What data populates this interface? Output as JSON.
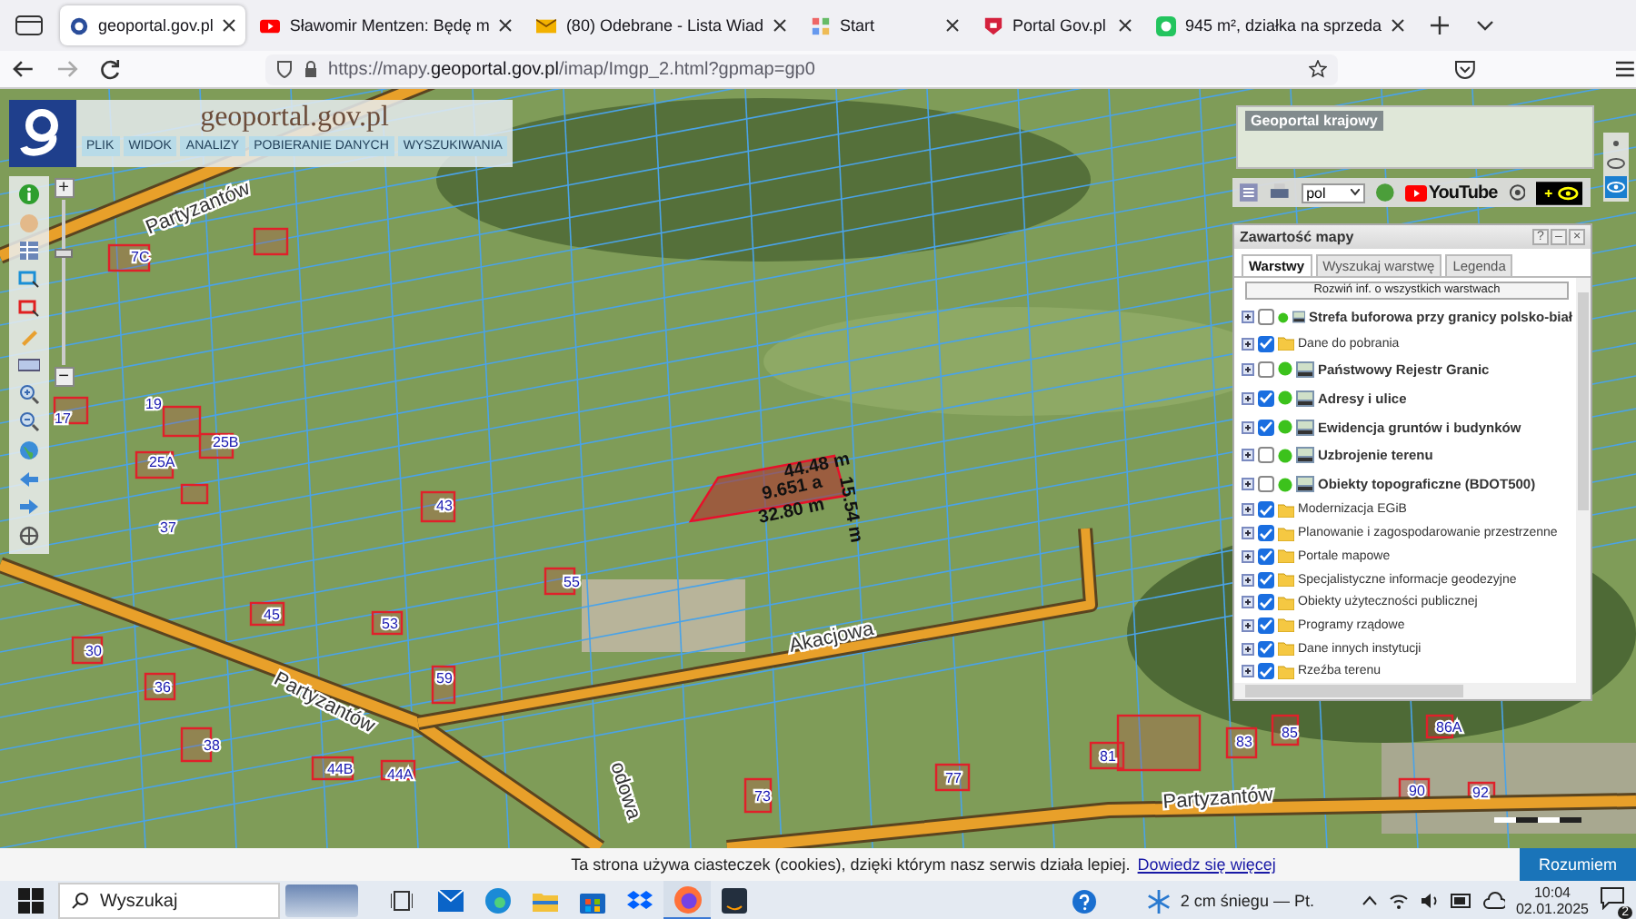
{
  "browser": {
    "tabs": [
      {
        "title": "geoportal.gov.pl",
        "kind": "geoportal",
        "selected": true
      },
      {
        "title": "Sławomir Mentzen: Będę m",
        "kind": "video",
        "selected": false
      },
      {
        "title": "(80) Odebrane - Lista Wiad",
        "kind": "mail",
        "selected": false
      },
      {
        "title": "Start",
        "kind": "start",
        "selected": false
      },
      {
        "title": "Portal Gov.pl",
        "kind": "gov",
        "selected": false
      },
      {
        "title": "945 m², działka na sprzeda",
        "kind": "listing",
        "selected": false
      }
    ],
    "url": "https://mapy.**geoportal.gov.pl**/imap/Imgp_2.html?gpmap=gp0"
  },
  "map": {
    "header": {
      "logo_title": "geoportal.gov.pl",
      "menu": [
        "PLIK",
        "WIDOK",
        "ANALIZY",
        "POBIERANIE DANYCH",
        "WYSZUKIWANIA"
      ]
    },
    "zoom": {
      "in": "+",
      "out": "−",
      "level": 0.7
    },
    "street_labels": [
      "Partyzantów",
      "Partyzantów",
      "Akacjowa",
      "Partyzantów",
      "odowa"
    ],
    "house_numbers": [
      "7C",
      "25B",
      "25A",
      "17",
      "19",
      "43",
      "37",
      "55",
      "53",
      "45",
      "59",
      "38",
      "44B",
      "44A",
      "73",
      "77",
      "81",
      "83",
      "85",
      "86A",
      "90",
      "92",
      "30",
      "36"
    ],
    "measurements": [
      "44.48 m",
      "9.651 a",
      "32.80 m",
      "15.54 m"
    ],
    "overview": {
      "title": "Geoportal krajowy"
    },
    "toolbar": {
      "language": "pol",
      "video": "YouTube"
    },
    "contents_panel": {
      "title": "Zawartość mapy",
      "window_buttons": [
        "?",
        "–",
        "×"
      ],
      "tabs": [
        {
          "label": "Warstwy",
          "selected": true
        },
        {
          "label": "Wyszukaj warstwę",
          "selected": false
        },
        {
          "label": "Legenda",
          "selected": false
        }
      ],
      "expand_button": "Rozwiń inf. o wszystkich warstwach",
      "layers": [
        {
          "name": "Strefa buforowa przy granicy polsko-biał",
          "kind": "service",
          "checked": false
        },
        {
          "name": "Dane do pobrania",
          "kind": "folder",
          "checked": true
        },
        {
          "name": "Państwowy Rejestr Granic",
          "kind": "service",
          "checked": false
        },
        {
          "name": "Adresy i ulice",
          "kind": "service",
          "checked": true
        },
        {
          "name": "Ewidencja gruntów i budynków",
          "kind": "service",
          "checked": true
        },
        {
          "name": "Uzbrojenie terenu",
          "kind": "service",
          "checked": false
        },
        {
          "name": "Obiekty topograficzne (BDOT500)",
          "kind": "service",
          "checked": false
        },
        {
          "name": "Modernizacja EGiB",
          "kind": "folder",
          "checked": true
        },
        {
          "name": "Planowanie i zagospodarowanie przestrzenne",
          "kind": "folder",
          "checked": true
        },
        {
          "name": "Portale mapowe",
          "kind": "folder",
          "checked": true
        },
        {
          "name": "Specjalistyczne informacje geodezyjne",
          "kind": "folder",
          "checked": true
        },
        {
          "name": "Obiekty użyteczności publicznej",
          "kind": "folder",
          "checked": true
        },
        {
          "name": "Programy rządowe",
          "kind": "folder",
          "checked": true
        },
        {
          "name": "Dane innych instytucji",
          "kind": "folder",
          "checked": true
        },
        {
          "name": "Rzeźba terenu",
          "kind": "folder",
          "checked": true
        }
      ]
    }
  },
  "cookie_bar": {
    "text": "Ta strona używa ciasteczek (cookies), dzięki którym nasz serwis działa lepiej.",
    "link": "Dowiedz się więcej",
    "button": "Rozumiem"
  },
  "taskbar": {
    "search": "Wyszukaj",
    "apps": [
      {
        "kind": "mail",
        "active": false
      },
      {
        "kind": "edge",
        "active": false
      },
      {
        "kind": "explorer",
        "active": false
      },
      {
        "kind": "store",
        "active": false
      },
      {
        "kind": "dropbox",
        "active": false
      },
      {
        "kind": "firefox",
        "active": true
      },
      {
        "kind": "amazon",
        "active": false
      }
    ],
    "weather": "2 cm śniegu — Pt.",
    "time": "10:04",
    "date": "02.01.2025",
    "notifications": "2"
  }
}
